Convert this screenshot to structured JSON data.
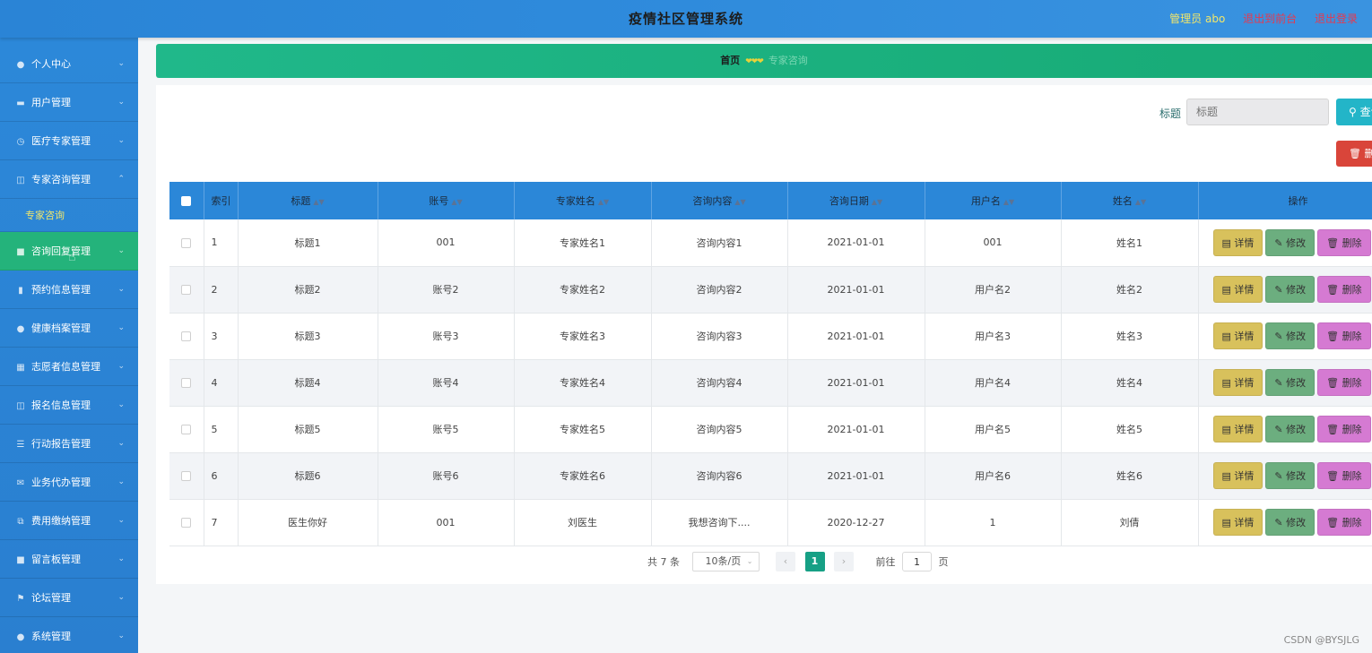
{
  "header": {
    "title": "疫情社区管理系统",
    "admin_label": "管理员 abo",
    "link_front": "退出到前台",
    "link_logout": "退出登录"
  },
  "sidebar": {
    "items": [
      {
        "label": "个人中心",
        "icon": "person-icon"
      },
      {
        "label": "用户管理",
        "icon": "monitor-icon"
      },
      {
        "label": "医疗专家管理",
        "icon": "clock-icon"
      },
      {
        "label": "专家咨询管理",
        "icon": "clipboard-icon"
      },
      {
        "label": "咨询回复管理",
        "icon": "chat-icon"
      },
      {
        "label": "预约信息管理",
        "icon": "bars-icon"
      },
      {
        "label": "健康档案管理",
        "icon": "person-icon"
      },
      {
        "label": "志愿者信息管理",
        "icon": "grid-icon"
      },
      {
        "label": "报名信息管理",
        "icon": "clipboard-icon"
      },
      {
        "label": "行动报告管理",
        "icon": "list-icon"
      },
      {
        "label": "业务代办管理",
        "icon": "mail-icon"
      },
      {
        "label": "费用缴纳管理",
        "icon": "copy-icon"
      },
      {
        "label": "留言板管理",
        "icon": "chat-icon"
      },
      {
        "label": "论坛管理",
        "icon": "flag-icon"
      },
      {
        "label": "系统管理",
        "icon": "person-icon"
      }
    ],
    "sub_item": "专家咨询"
  },
  "breadcrumb": {
    "home": "首页",
    "separator": "❤❤❤",
    "current": "专家咨询"
  },
  "search": {
    "label": "标题",
    "placeholder": "标题",
    "button_label": "查询",
    "delete_label": "删除"
  },
  "table": {
    "headers": [
      "索引",
      "标题",
      "账号",
      "专家姓名",
      "咨询内容",
      "咨询日期",
      "用户名",
      "姓名",
      "操作"
    ],
    "rows": [
      [
        "1",
        "标题1",
        "001",
        "专家姓名1",
        "咨询内容1",
        "2021-01-01",
        "001",
        "姓名1"
      ],
      [
        "2",
        "标题2",
        "账号2",
        "专家姓名2",
        "咨询内容2",
        "2021-01-01",
        "用户名2",
        "姓名2"
      ],
      [
        "3",
        "标题3",
        "账号3",
        "专家姓名3",
        "咨询内容3",
        "2021-01-01",
        "用户名3",
        "姓名3"
      ],
      [
        "4",
        "标题4",
        "账号4",
        "专家姓名4",
        "咨询内容4",
        "2021-01-01",
        "用户名4",
        "姓名4"
      ],
      [
        "5",
        "标题5",
        "账号5",
        "专家姓名5",
        "咨询内容5",
        "2021-01-01",
        "用户名5",
        "姓名5"
      ],
      [
        "6",
        "标题6",
        "账号6",
        "专家姓名6",
        "咨询内容6",
        "2021-01-01",
        "用户名6",
        "姓名6"
      ],
      [
        "7",
        "医生你好",
        "001",
        "刘医生",
        "我想咨询下....",
        "2020-12-27",
        "1",
        "刘倩"
      ]
    ],
    "actions": {
      "detail": "详情",
      "edit": "修改",
      "delete": "删除"
    }
  },
  "pagination": {
    "total": "共 7 条",
    "page_size": "10条/页",
    "current_page": "1",
    "goto_prefix": "前往",
    "goto_value": "1",
    "goto_suffix": "页"
  },
  "watermark": "CSDN @BYSJLG",
  "colors": {
    "header_bg": "#2f8bdc",
    "sidebar_active": "#24b37b",
    "breadcrumb_bg": "#17aa75",
    "table_header": "#2b87d8",
    "detail_btn": "#d8c15c",
    "edit_btn": "#6cae7f",
    "delete_btn": "#d57ad2"
  }
}
